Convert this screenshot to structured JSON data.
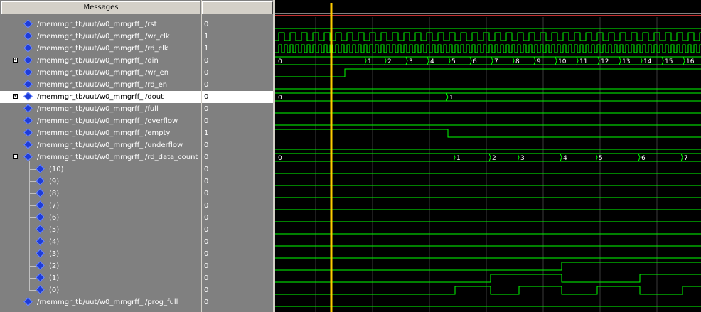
{
  "header": {
    "messages_label": "Messages",
    "values_label": ""
  },
  "colors": {
    "wave": "#00ff00",
    "cursor": "#ffcc00",
    "background": "#000000",
    "selected_row": "#ffffff",
    "diamond": "#1e3cd8"
  },
  "signals": [
    {
      "name": "/memmgr_tb/uut/w0_mmgrff_i/rst",
      "value": "0",
      "expandable": false,
      "expanded": false,
      "selected": false,
      "child": false,
      "icon": "signal-diamond-icon"
    },
    {
      "name": "/memmgr_tb/uut/w0_mmgrff_i/wr_clk",
      "value": "1",
      "expandable": false,
      "expanded": false,
      "selected": false,
      "child": false,
      "icon": "signal-diamond-icon"
    },
    {
      "name": "/memmgr_tb/uut/w0_mmgrff_i/rd_clk",
      "value": "1",
      "expandable": false,
      "expanded": false,
      "selected": false,
      "child": false,
      "icon": "signal-diamond-icon"
    },
    {
      "name": "/memmgr_tb/uut/w0_mmgrff_i/din",
      "value": "0",
      "expandable": true,
      "expanded": false,
      "selected": false,
      "child": false,
      "icon": "signal-diamond-icon"
    },
    {
      "name": "/memmgr_tb/uut/w0_mmgrff_i/wr_en",
      "value": "0",
      "expandable": false,
      "expanded": false,
      "selected": false,
      "child": false,
      "icon": "signal-diamond-icon"
    },
    {
      "name": "/memmgr_tb/uut/w0_mmgrff_i/rd_en",
      "value": "0",
      "expandable": false,
      "expanded": false,
      "selected": false,
      "child": false,
      "icon": "signal-diamond-icon"
    },
    {
      "name": "/memmgr_tb/uut/w0_mmgrff_i/dout",
      "value": "0",
      "expandable": true,
      "expanded": false,
      "selected": true,
      "child": false,
      "icon": "signal-diamond-icon"
    },
    {
      "name": "/memmgr_tb/uut/w0_mmgrff_i/full",
      "value": "0",
      "expandable": false,
      "expanded": false,
      "selected": false,
      "child": false,
      "icon": "signal-diamond-icon"
    },
    {
      "name": "/memmgr_tb/uut/w0_mmgrff_i/overflow",
      "value": "0",
      "expandable": false,
      "expanded": false,
      "selected": false,
      "child": false,
      "icon": "signal-diamond-icon"
    },
    {
      "name": "/memmgr_tb/uut/w0_mmgrff_i/empty",
      "value": "1",
      "expandable": false,
      "expanded": false,
      "selected": false,
      "child": false,
      "icon": "signal-diamond-icon"
    },
    {
      "name": "/memmgr_tb/uut/w0_mmgrff_i/underflow",
      "value": "0",
      "expandable": false,
      "expanded": false,
      "selected": false,
      "child": false,
      "icon": "signal-diamond-icon"
    },
    {
      "name": "/memmgr_tb/uut/w0_mmgrff_i/rd_data_count",
      "value": "0",
      "expandable": true,
      "expanded": true,
      "selected": false,
      "child": false,
      "icon": "signal-diamond-icon"
    },
    {
      "name": "(10)",
      "value": "0",
      "expandable": false,
      "expanded": false,
      "selected": false,
      "child": true,
      "icon": "signal-diamond-icon"
    },
    {
      "name": "(9)",
      "value": "0",
      "expandable": false,
      "expanded": false,
      "selected": false,
      "child": true,
      "icon": "signal-diamond-icon"
    },
    {
      "name": "(8)",
      "value": "0",
      "expandable": false,
      "expanded": false,
      "selected": false,
      "child": true,
      "icon": "signal-diamond-icon"
    },
    {
      "name": "(7)",
      "value": "0",
      "expandable": false,
      "expanded": false,
      "selected": false,
      "child": true,
      "icon": "signal-diamond-icon"
    },
    {
      "name": "(6)",
      "value": "0",
      "expandable": false,
      "expanded": false,
      "selected": false,
      "child": true,
      "icon": "signal-diamond-icon"
    },
    {
      "name": "(5)",
      "value": "0",
      "expandable": false,
      "expanded": false,
      "selected": false,
      "child": true,
      "icon": "signal-diamond-icon"
    },
    {
      "name": "(4)",
      "value": "0",
      "expandable": false,
      "expanded": false,
      "selected": false,
      "child": true,
      "icon": "signal-diamond-icon"
    },
    {
      "name": "(3)",
      "value": "0",
      "expandable": false,
      "expanded": false,
      "selected": false,
      "child": true,
      "icon": "signal-diamond-icon"
    },
    {
      "name": "(2)",
      "value": "0",
      "expandable": false,
      "expanded": false,
      "selected": false,
      "child": true,
      "icon": "signal-diamond-icon"
    },
    {
      "name": "(1)",
      "value": "0",
      "expandable": false,
      "expanded": false,
      "selected": false,
      "child": true,
      "icon": "signal-diamond-icon"
    },
    {
      "name": "(0)",
      "value": "0",
      "expandable": false,
      "expanded": false,
      "selected": false,
      "child": true,
      "icon": "signal-diamond-icon"
    },
    {
      "name": "/memmgr_tb/uut/w0_mmgrff_i/prog_full",
      "value": "0",
      "expandable": false,
      "expanded": false,
      "selected": false,
      "child": false,
      "icon": "signal-diamond-icon"
    }
  ],
  "bus_labels": {
    "din": [
      "0",
      "1",
      "2",
      "3",
      "4",
      "5",
      "6",
      "7",
      "8",
      "9",
      "10",
      "11",
      "12",
      "13",
      "14",
      "15",
      "16"
    ],
    "dout": [
      "0",
      "1"
    ],
    "rd_data_count": [
      "0",
      "1",
      "2",
      "3",
      "4",
      "5",
      "6",
      "7"
    ]
  }
}
